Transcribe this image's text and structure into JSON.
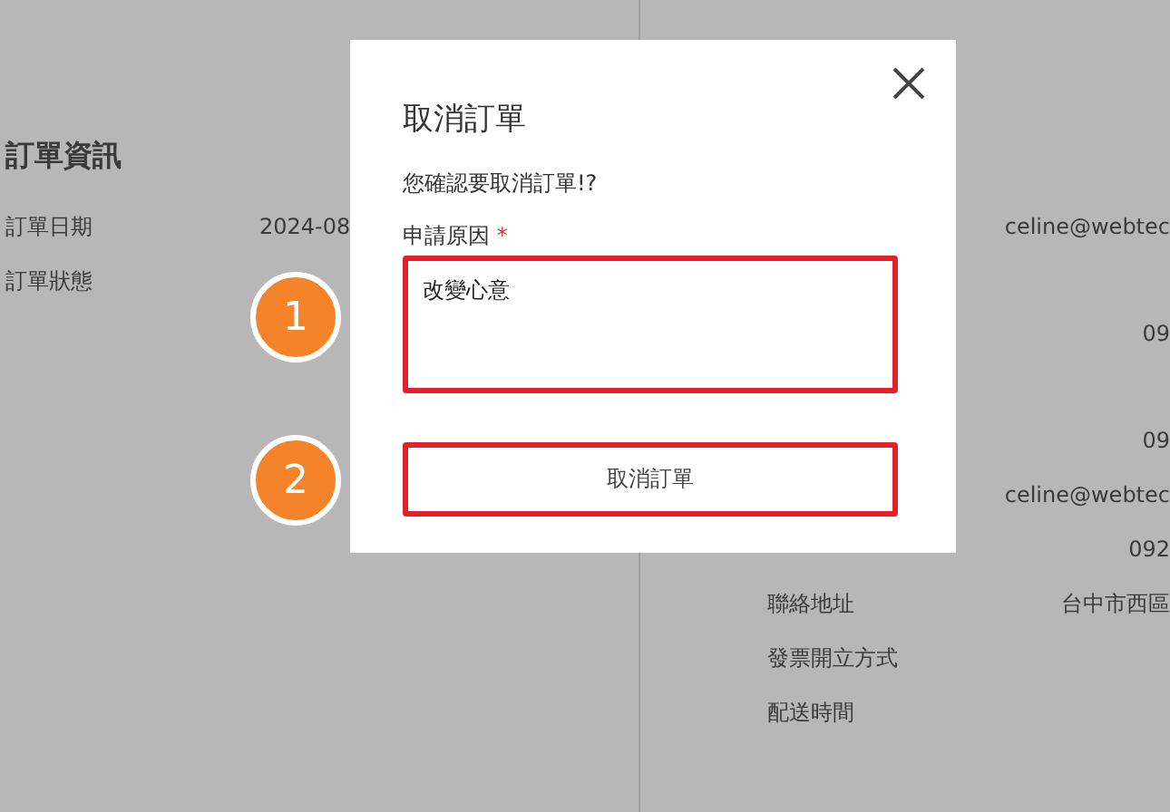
{
  "order_info": {
    "title": "訂單資訊",
    "rows": [
      {
        "label": "訂單日期",
        "value": "2024-08"
      },
      {
        "label": "訂單狀態"
      }
    ]
  },
  "contact_info": {
    "sections": [
      {
        "rows": [
          {
            "value": "celine@webtec"
          }
        ]
      },
      {
        "rows": [
          {
            "value": "09"
          }
        ]
      },
      {
        "rows": [
          {
            "value": "09"
          },
          {
            "value": "celine@webtec"
          },
          {
            "value": "092"
          },
          {
            "label": "聯絡地址",
            "value": "台中市西區"
          },
          {
            "label": "發票開立方式"
          },
          {
            "label": "配送時間"
          }
        ]
      }
    ]
  },
  "dialog": {
    "title": "取消訂單",
    "message": "您確認要取消訂單!?",
    "field_label": "申請原因",
    "required_mark": "*",
    "reason": "改變心意",
    "button": "取消訂單"
  },
  "markers": [
    {
      "number": "1"
    },
    {
      "number": "2"
    }
  ]
}
